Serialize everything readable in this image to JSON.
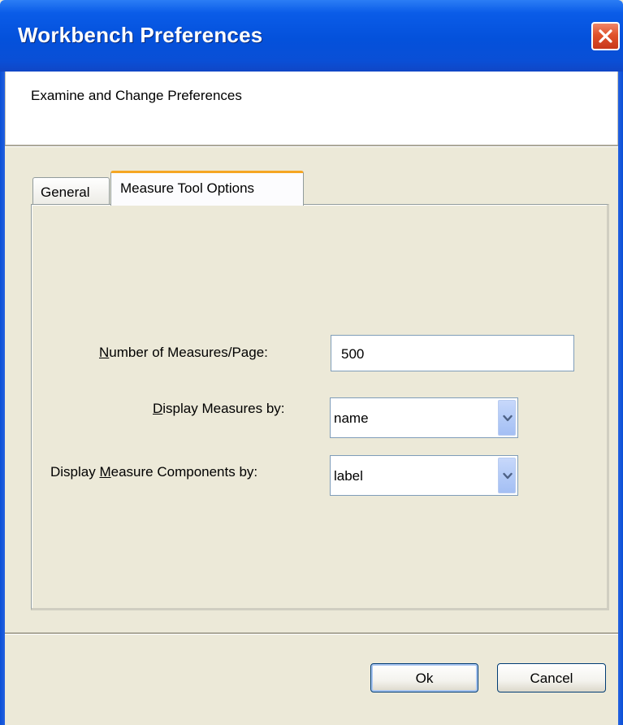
{
  "window": {
    "title": "Workbench Preferences"
  },
  "header": {
    "text": "Examine and Change Preferences"
  },
  "tabs": [
    {
      "label": "General",
      "selected": false
    },
    {
      "label": "Measure Tool Options",
      "selected": true
    }
  ],
  "form": {
    "measures_per_page": {
      "label": "Number of Measures/Page:",
      "mnemonic": "N",
      "value": "500"
    },
    "display_measures_by": {
      "label": "Display Measures by:",
      "mnemonic": "D",
      "value": "name"
    },
    "display_components_by": {
      "label": "Display Measure Components by:",
      "mnemonic": "M",
      "value": "label"
    }
  },
  "buttons": {
    "ok": "Ok",
    "cancel": "Cancel"
  },
  "colors": {
    "title_bar": "#0a5ce8",
    "close_button": "#e0522c",
    "active_tab_accent": "#f5a623",
    "dialog_background": "#ece9d8"
  },
  "icons": {
    "close": "close-x-icon",
    "dropdown": "chevron-down-icon"
  }
}
